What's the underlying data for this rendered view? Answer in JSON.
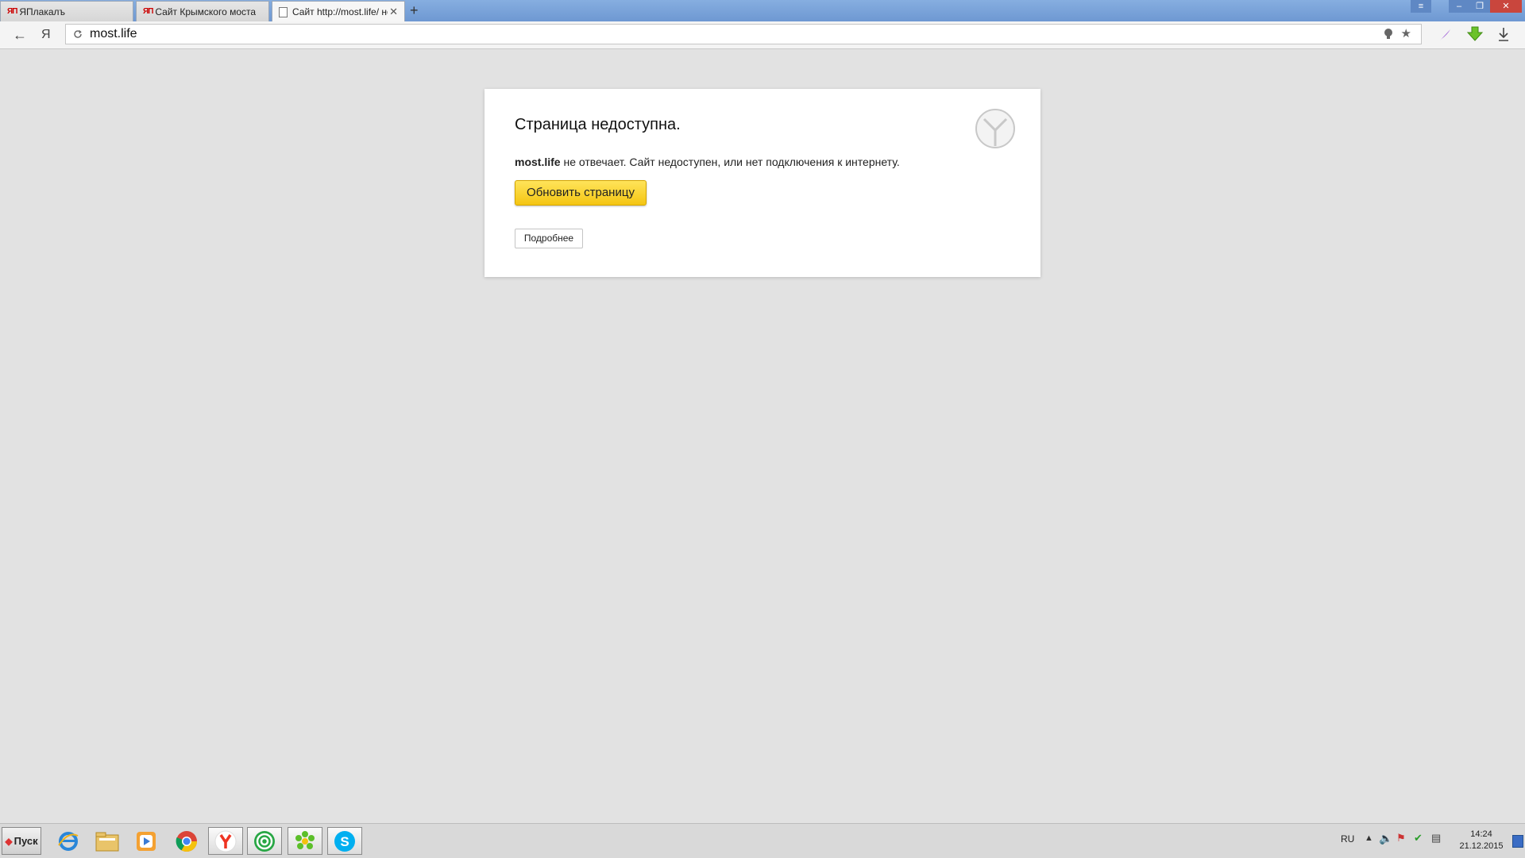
{
  "tabs": [
    {
      "icon_text": "ЯП",
      "label": "ЯПлакалъ",
      "active": false
    },
    {
      "icon_text": "ЯП",
      "label": "Сайт Крымского моста",
      "active": false
    },
    {
      "icon_text": "",
      "label": "Сайт http://most.life/ не",
      "active": true
    }
  ],
  "toolbar": {
    "back_icon": "←",
    "yandex_icon": "Я",
    "address": "most.life"
  },
  "error": {
    "title": "Страница недоступна.",
    "site": "most.life",
    "message": " не отвечает. Сайт недоступен, или нет подключения к интернету.",
    "reload_label": "Обновить страницу",
    "details_label": "Подробнее"
  },
  "taskbar": {
    "start_label": "Пуск",
    "apps": [
      "internet-explorer-icon",
      "file-explorer-icon",
      "media-player-icon",
      "chrome-icon",
      "yandex-browser-icon",
      "mail-agent-icon",
      "icq-icon",
      "skype-icon"
    ],
    "language": "RU",
    "time": "14:24",
    "date": "21.12.2015"
  }
}
